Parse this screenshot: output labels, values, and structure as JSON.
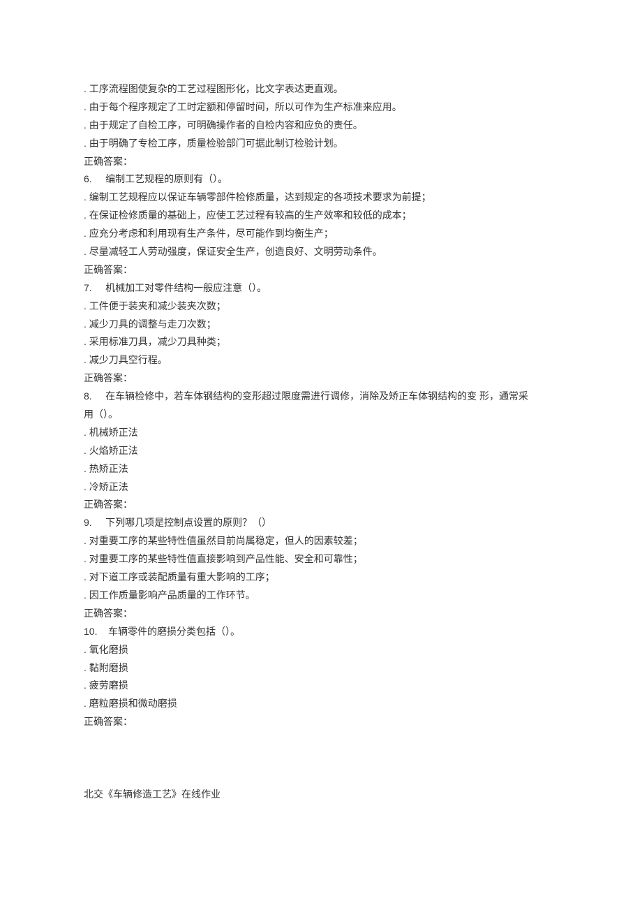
{
  "q5_tail": {
    "opts": [
      ". 工序流程图使复杂的工艺过程图形化，比文字表达更直观。",
      ". 由于每个程序规定了工时定额和停留时间，所以可作为生产标准来应用。",
      ". 由于规定了自检工序，可明确操作者的自检内容和应负的责任。",
      ". 由于明确了专检工序，质量检验部门可据此制订检验计划。"
    ],
    "answer_label": "正确答案："
  },
  "q6": {
    "num": "6.",
    "stem": "编制工艺规程的原则有（）。",
    "opts": [
      ". 编制工艺规程应以保证车辆零部件检修质量，达到规定的各项技术要求为前提；",
      ". 在保证检修质量的基础上，应使工艺过程有较高的生产效率和较低的成本；",
      ". 应充分考虑和利用现有生产条件，尽可能作到均衡生产；",
      ". 尽量减轻工人劳动强度，保证安全生产，创造良好、文明劳动条件。"
    ],
    "answer_label": "正确答案："
  },
  "q7": {
    "num": "7.",
    "stem": "机械加工对零件结构一般应注意（）。",
    "opts": [
      ". 工件便于装夹和减少装夹次数；",
      ". 减少刀具的调整与走刀次数；",
      ". 采用标准刀具，减少刀具种类；",
      ". 减少刀具空行程。"
    ],
    "answer_label": "正确答案："
  },
  "q8": {
    "num": "8.",
    "stem_line1": "在车辆检修中，若车体钢结构的变形超过限度需进行调修，消除及矫正车体钢结构的变 形，通常采",
    "stem_line2": "用（）。",
    "opts": [
      ". 机械矫正法",
      ". 火焰矫正法",
      ". 热矫正法",
      ". 冷矫正法"
    ],
    "answer_label": "正确答案："
  },
  "q9": {
    "num": "9.",
    "stem": "下列哪几项是控制点设置的原则？（）",
    "opts": [
      ". 对重要工序的某些特性值虽然目前尚属稳定，但人的因素较差；",
      ". 对重要工序的某些特性值直接影响到产品性能、安全和可靠性；",
      ". 对下道工序或装配质量有重大影响的工序；",
      ". 因工作质量影响产品质量的工作环节。"
    ],
    "answer_label": "正确答案："
  },
  "q10": {
    "num": "10.",
    "stem": "车辆零件的磨损分类包括（）。",
    "opts": [
      ". 氧化磨损",
      ". 黏附磨损",
      ". 疲劳磨损",
      ". 磨粒磨损和微动磨损"
    ],
    "answer_label": "正确答案："
  },
  "footer": "北交《车辆修造工艺》在线作业"
}
